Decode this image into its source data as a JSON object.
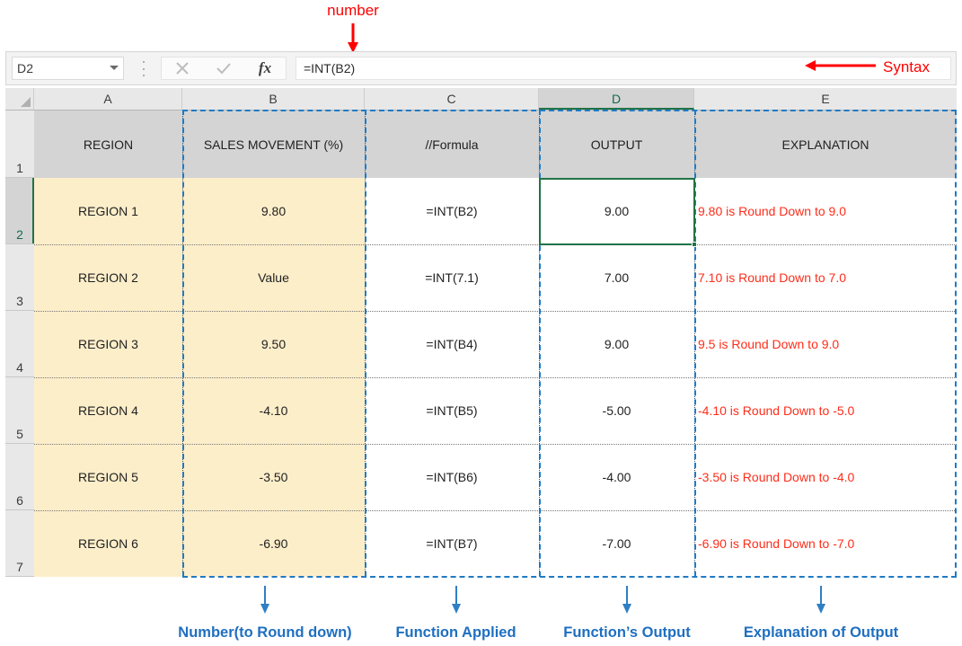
{
  "annotations": {
    "top": {
      "label": "number",
      "arrow": "down-arrow-red"
    },
    "syntax": {
      "label": "Syntax",
      "arrow": "left-arrow-red"
    },
    "bottom": [
      {
        "label": "Number(to Round down)",
        "arrow": "down-arrow-blue"
      },
      {
        "label": "Function Applied",
        "arrow": "down-arrow-blue"
      },
      {
        "label": "Function’s Output",
        "arrow": "down-arrow-blue"
      },
      {
        "label": "Explanation of Output",
        "arrow": "down-arrow-blue"
      }
    ]
  },
  "formula_bar": {
    "name_box_value": "D2",
    "formula_value": "=INT(B2)",
    "cancel_icon": "close-icon",
    "enter_icon": "check-icon",
    "insert_function_icon": "fx-icon",
    "insert_function_label": "fx"
  },
  "grid": {
    "column_headers": [
      "A",
      "B",
      "C",
      "D",
      "E"
    ],
    "active_column": "D",
    "active_row": "2",
    "active_cell": "D2",
    "row_numbers": [
      "1",
      "2",
      "3",
      "4",
      "5",
      "6",
      "7"
    ],
    "header_row": [
      "REGION",
      "SALES MOVEMENT (%)",
      "//Formula",
      "OUTPUT",
      "EXPLANATION"
    ],
    "rows": [
      {
        "row": "2",
        "region": "REGION 1",
        "sales_movement": "9.80",
        "formula": "=INT(B2)",
        "output": "9.00",
        "explanation": "9.80 is Round Down to 9.0"
      },
      {
        "row": "3",
        "region": "REGION 2",
        "sales_movement": "Value",
        "formula": "=INT(7.1)",
        "output": "7.00",
        "explanation": "7.10 is Round Down to 7.0"
      },
      {
        "row": "4",
        "region": "REGION 3",
        "sales_movement": "9.50",
        "formula": "=INT(B4)",
        "output": "9.00",
        "explanation": "9.5 is Round Down to 9.0"
      },
      {
        "row": "5",
        "region": "REGION 4",
        "sales_movement": "-4.10",
        "formula": "=INT(B5)",
        "output": "-5.00",
        "explanation": "-4.10 is Round Down to -5.0"
      },
      {
        "row": "6",
        "region": "REGION 5",
        "sales_movement": "-3.50",
        "formula": "=INT(B6)",
        "output": "-4.00",
        "explanation": "-3.50 is Round Down to -4.0"
      },
      {
        "row": "7",
        "region": "REGION 6",
        "sales_movement": "-6.90",
        "formula": "=INT(B7)",
        "output": "-7.00",
        "explanation": "-6.90 is Round Down to -7.0"
      }
    ]
  },
  "colors": {
    "annotation_red": "#ff0000",
    "annotation_blue": "#1f6fc0",
    "dash_blue": "#1f7ac4",
    "cell_tan": "#fdeeca",
    "header_gray": "#d4d4d4",
    "explanation_red": "#ff2d1a",
    "selection_green": "#217346"
  }
}
